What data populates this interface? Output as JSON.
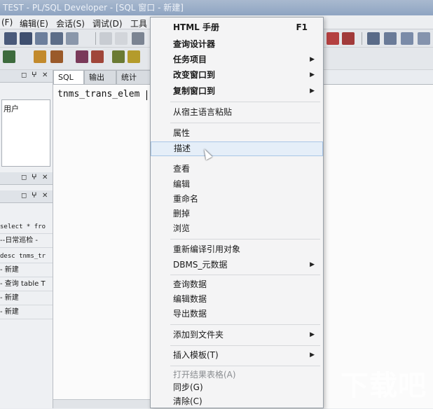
{
  "window": {
    "title": "TEST - PL/SQL Developer - [SQL 窗口 - 新建]"
  },
  "menubar": {
    "items": [
      "(F)",
      "编辑(E)",
      "会话(S)",
      "调试(D)",
      "工具"
    ]
  },
  "tabs": [
    "SQL",
    "输出",
    "统计"
  ],
  "left_pane": {
    "object_label": "用户",
    "history": [
      "select * fro",
      "--日常巡检 -",
      "desc tnms_tr",
      "- 新建",
      "- 查询 table T",
      "- 新建",
      "- 新建"
    ]
  },
  "editor": {
    "code": "tnms_trans_elem"
  },
  "context_menu": {
    "items": [
      {
        "label": "HTML 手册",
        "shortcut": "F1",
        "bold": true
      },
      {
        "label": "查询设计器",
        "bold": true
      },
      {
        "label": "任务项目",
        "submenu": true
      },
      {
        "label": "改变窗口到",
        "submenu": true
      },
      {
        "label": "复制窗口到",
        "submenu": true
      },
      {
        "label": "从宿主语言粘贴"
      },
      {
        "label": "属性"
      },
      {
        "label": "描述",
        "hover": true
      },
      {
        "label": "查看"
      },
      {
        "label": "编辑"
      },
      {
        "label": "重命名"
      },
      {
        "label": "删掉"
      },
      {
        "label": "浏览"
      },
      {
        "label": "重新编译引用对象"
      },
      {
        "label": "DBMS_元数据",
        "submenu": true
      },
      {
        "label": "查询数据"
      },
      {
        "label": "编辑数据"
      },
      {
        "label": "导出数据"
      },
      {
        "label": "添加到文件夹",
        "submenu": true
      },
      {
        "label": "插入模板(T)",
        "submenu": true
      },
      {
        "label": "打开结果表格(A)",
        "dim": true
      },
      {
        "label": "同步(G)"
      },
      {
        "label": "清除(C)"
      }
    ]
  },
  "watermark": "下载吧"
}
